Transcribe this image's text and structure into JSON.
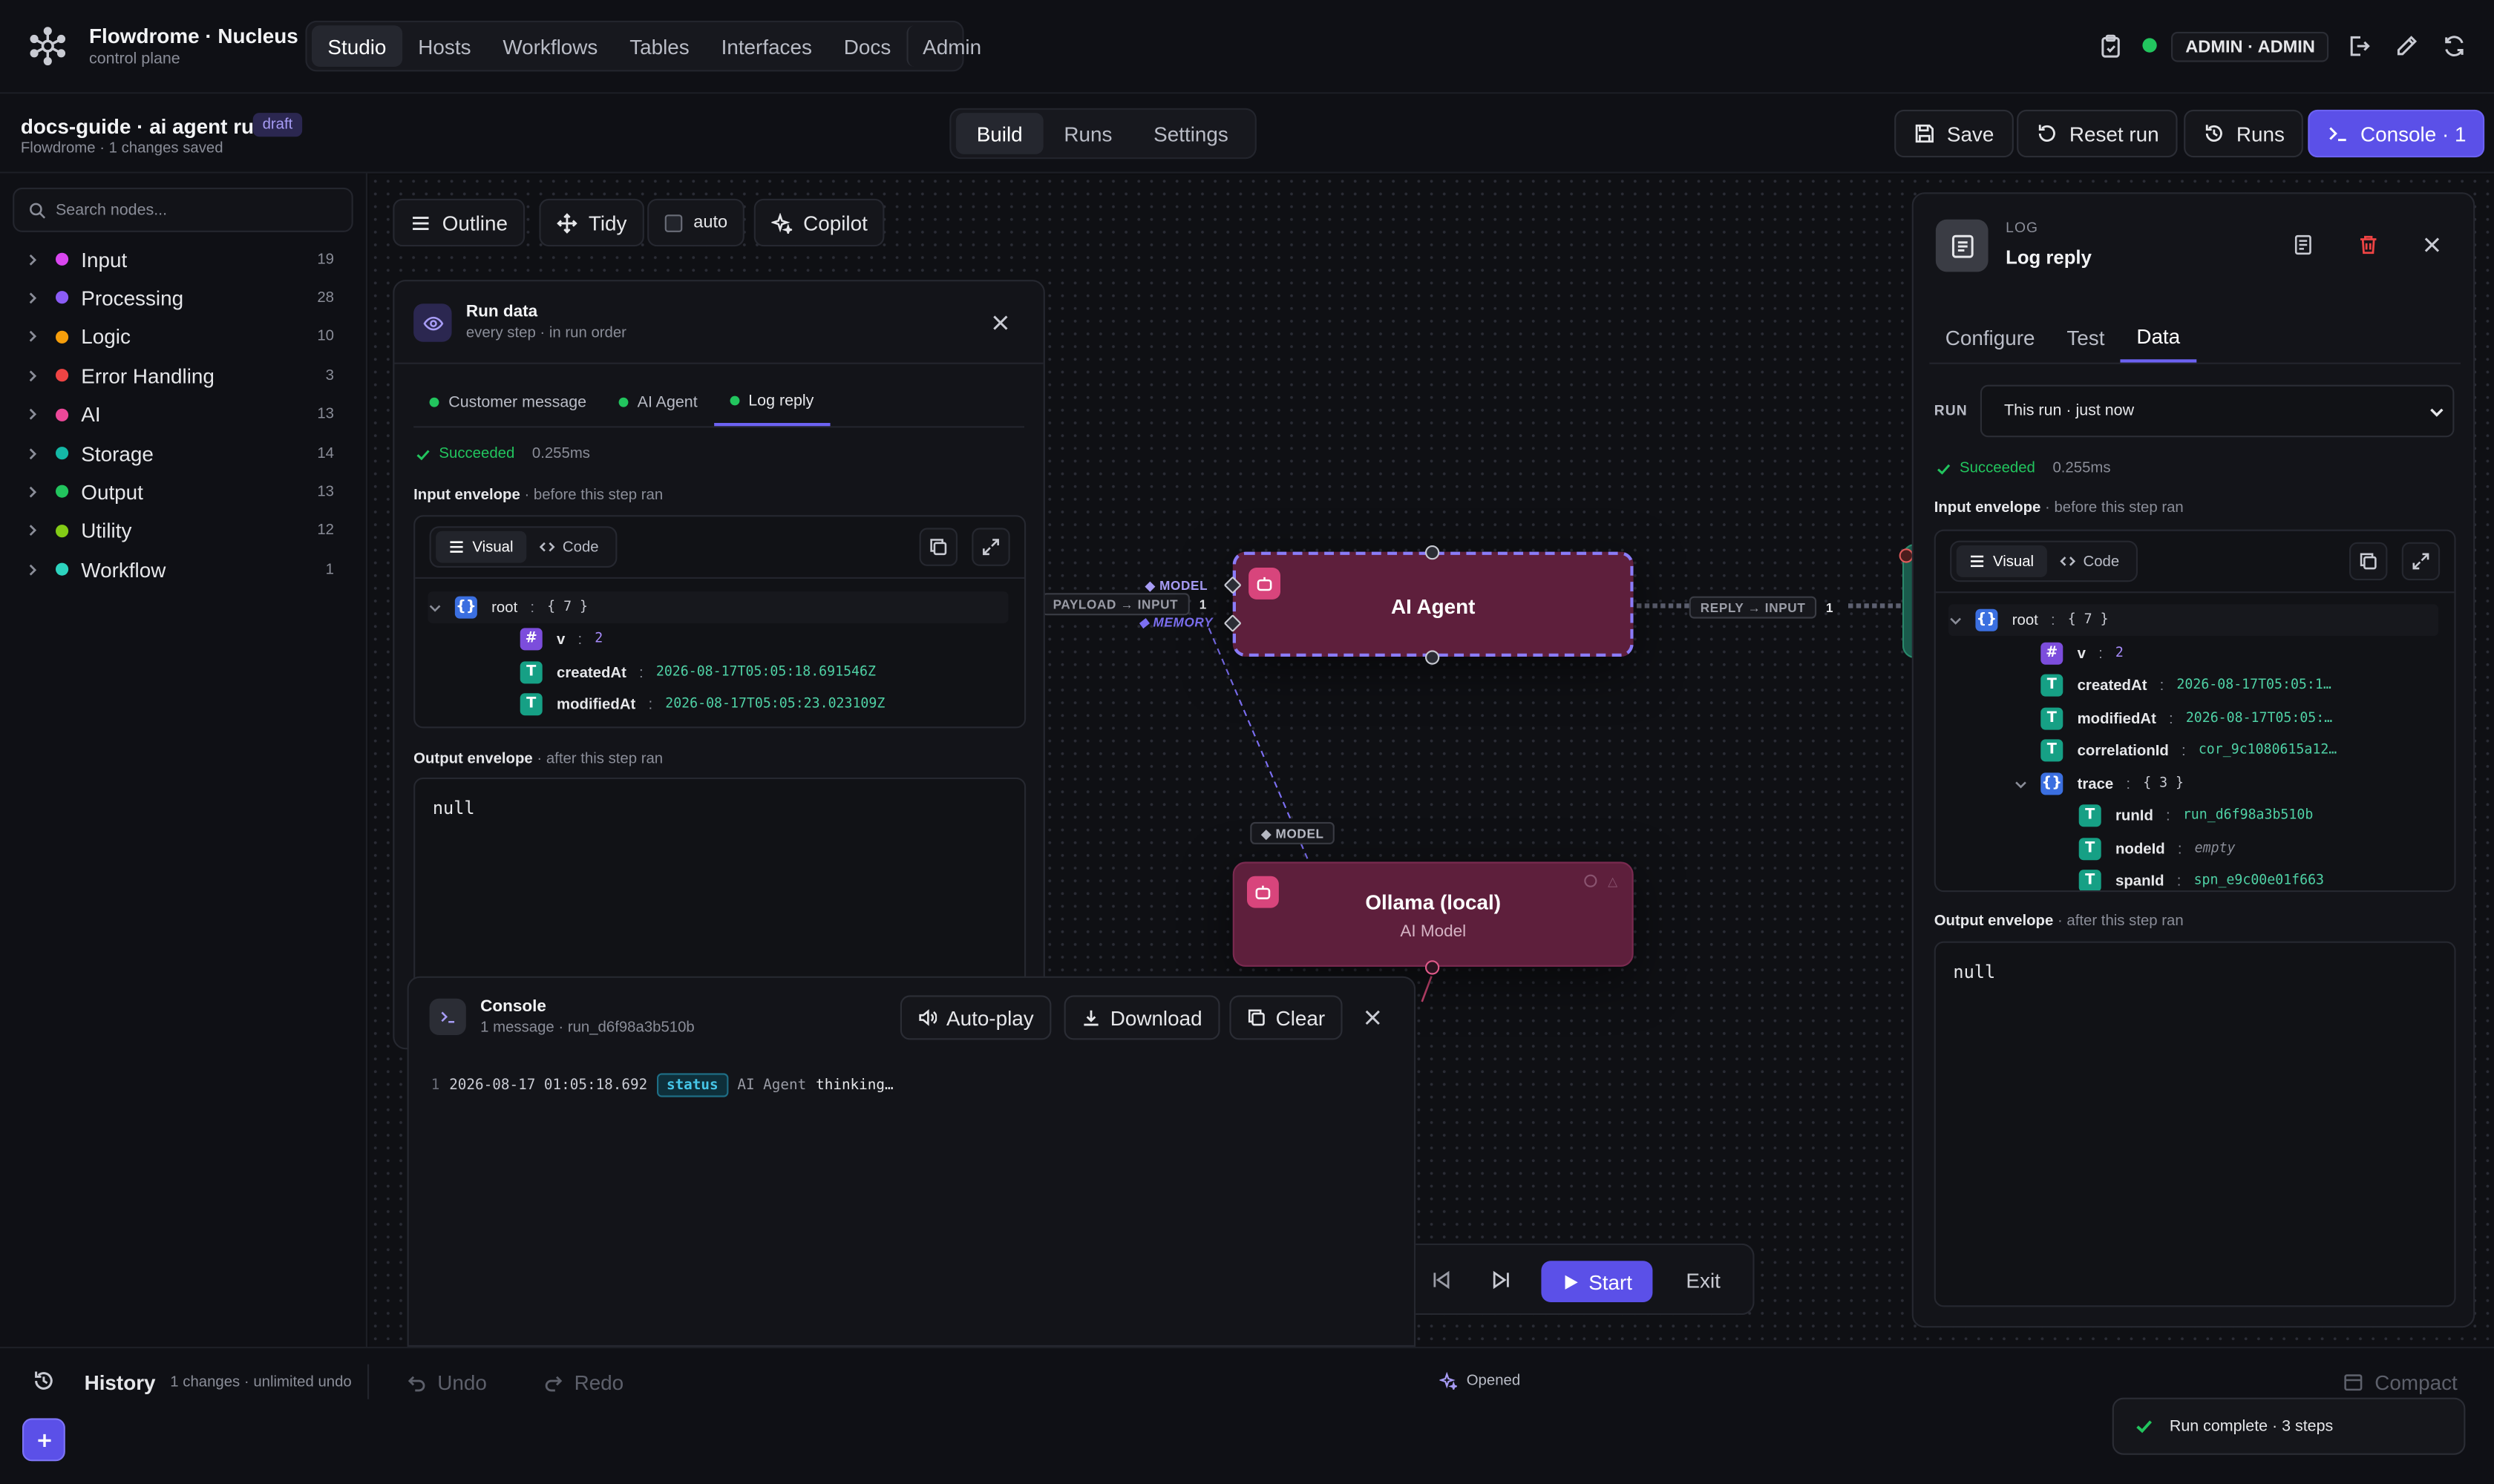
{
  "brand": {
    "title": "Flowdrome · Nucleus",
    "subtitle": "control plane"
  },
  "nav": [
    "Studio",
    "Hosts",
    "Workflows",
    "Tables",
    "Interfaces",
    "Docs",
    "Admin"
  ],
  "topbar": {
    "admin_label": "ADMIN · ADMIN"
  },
  "doc": {
    "title": "docs-guide · ai agent run",
    "badge": "draft",
    "subtitle": "Flowdrome · 1 changes saved"
  },
  "mode_tabs": [
    "Build",
    "Runs",
    "Settings"
  ],
  "actions": {
    "save": "Save",
    "reset": "Reset run",
    "runs": "Runs",
    "console": "Console · 1"
  },
  "sidebar": {
    "search_placeholder": "Search nodes...",
    "categories": [
      {
        "label": "Input",
        "count": "19",
        "color": "#d946ef"
      },
      {
        "label": "Processing",
        "count": "28",
        "color": "#8b5cf6"
      },
      {
        "label": "Logic",
        "count": "10",
        "color": "#f59e0b"
      },
      {
        "label": "Error Handling",
        "count": "3",
        "color": "#ef4444"
      },
      {
        "label": "AI",
        "count": "13",
        "color": "#ec4899"
      },
      {
        "label": "Storage",
        "count": "14",
        "color": "#14b8a6"
      },
      {
        "label": "Output",
        "count": "13",
        "color": "#22c55e"
      },
      {
        "label": "Utility",
        "count": "12",
        "color": "#84cc16"
      },
      {
        "label": "Workflow",
        "count": "1",
        "color": "#2dd4bf"
      }
    ]
  },
  "canvas_toolbar": {
    "outline": "Outline",
    "tidy": "Tidy",
    "auto": "auto",
    "copilot": "Copilot"
  },
  "nodes": {
    "ai_agent": {
      "title": "AI Agent"
    },
    "ollama": {
      "title": "Ollama (local)",
      "subtitle": "AI Model"
    }
  },
  "ports": {
    "model": "◆ MODEL",
    "memory": "◆ MEMORY",
    "model2": "◆ MODEL"
  },
  "edges": {
    "payload": "PAYLOAD → INPUT",
    "payload_count": "1",
    "reply": "REPLY → INPUT",
    "reply_count": "1"
  },
  "run_data": {
    "title": "Run data",
    "subtitle": "every step · in run order",
    "tabs": [
      "Customer message",
      "AI Agent",
      "Log reply"
    ],
    "status": "Succeeded",
    "duration": "0.255ms",
    "input_label": "Input envelope",
    "input_hint": " · before this step ran",
    "view_visual": "Visual",
    "view_code": "Code",
    "tree": {
      "root_key": "root",
      "root_val": "{ 7 }",
      "v_key": "v",
      "v_val": "2",
      "created_key": "createdAt",
      "created_val": "2026-08-17T05:05:18.691546Z",
      "modified_key": "modifiedAt",
      "modified_val": "2026-08-17T05:05:23.023109Z"
    },
    "output_label": "Output envelope",
    "output_hint": " · after this step ran",
    "output_value": "null"
  },
  "log_panel": {
    "kind": "LOG",
    "title": "Log reply",
    "tabs": [
      "Configure",
      "Test",
      "Data"
    ],
    "run_label": "RUN",
    "run_select": "This run · just now",
    "status": "Succeeded",
    "duration": "0.255ms",
    "input_label": "Input envelope",
    "input_hint": " · before this step ran",
    "view_visual": "Visual",
    "view_code": "Code",
    "tree": {
      "root_key": "root",
      "root_val": "{ 7 }",
      "v_key": "v",
      "v_val": "2",
      "created_key": "createdAt",
      "created_val": "2026-08-17T05:05:1…",
      "modified_key": "modifiedAt",
      "modified_val": "2026-08-17T05:05:…",
      "corr_key": "correlationId",
      "corr_val": "cor_9c1080615a12…",
      "trace_key": "trace",
      "trace_val": "{ 3 }",
      "runid_key": "runId",
      "runid_val": "run_d6f98a3b510b",
      "nodeid_key": "nodeId",
      "nodeid_val": "empty",
      "spanid_key": "spanId",
      "spanid_val": "spn_e9c00e01f663"
    },
    "output_label": "Output envelope",
    "output_hint": " · after this step ran",
    "output_value": "null"
  },
  "console": {
    "title": "Console",
    "subtitle": "1 message · run_d6f98a3b510b",
    "autoplay": "Auto-play",
    "download": "Download",
    "clear": "Clear",
    "line": {
      "num": "1",
      "time": "2026-08-17 01:05:18.692",
      "level": "status",
      "source": "AI Agent",
      "message": "thinking…"
    }
  },
  "run_controls": {
    "start": "Start",
    "exit": "Exit"
  },
  "bottombar": {
    "history": "History",
    "history_info": "1 changes · unlimited undo",
    "undo": "Undo",
    "redo": "Redo",
    "opened": "Opened",
    "compact": "Compact"
  },
  "toast": {
    "message": "Run complete · 3 steps"
  }
}
